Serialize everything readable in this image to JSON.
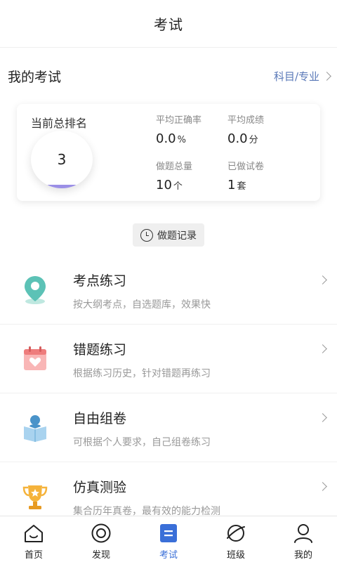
{
  "header": {
    "title": "考试"
  },
  "section": {
    "title": "我的考试",
    "link_label": "科目/专业"
  },
  "summary": {
    "rank_label": "当前总排名",
    "rank_value": "3",
    "stats": [
      {
        "label": "平均正确率",
        "value": "0.0",
        "unit": "%"
      },
      {
        "label": "平均成绩",
        "value": "0.0",
        "unit": "分"
      },
      {
        "label": "做题总量",
        "value": "10",
        "unit": "个"
      },
      {
        "label": "已做试卷",
        "value": "1",
        "unit": "套"
      }
    ]
  },
  "record_button": {
    "label": "做题记录",
    "icon": "clock-icon"
  },
  "practice_items": [
    {
      "title": "考点练习",
      "desc": "按大纲考点，自选题库，效果快",
      "icon": "location-pin-icon"
    },
    {
      "title": "错题练习",
      "desc": "根据练习历史，针对错题再练习",
      "icon": "calendar-heart-icon"
    },
    {
      "title": "自由组卷",
      "desc": "可根据个人要求，自己组卷练习",
      "icon": "reader-book-icon"
    },
    {
      "title": "仿真测验",
      "desc": "集合历年真卷，最有效的能力检测",
      "icon": "trophy-icon"
    }
  ],
  "tabs": [
    {
      "label": "首页",
      "icon": "home-icon"
    },
    {
      "label": "发现",
      "icon": "discover-icon"
    },
    {
      "label": "考试",
      "icon": "exam-icon",
      "active": true
    },
    {
      "label": "班级",
      "icon": "planet-icon"
    },
    {
      "label": "我的",
      "icon": "user-icon"
    }
  ],
  "colors": {
    "accent": "#3a6fd8",
    "link": "#5a79b8",
    "rank_bar": "#9b8fe6"
  }
}
